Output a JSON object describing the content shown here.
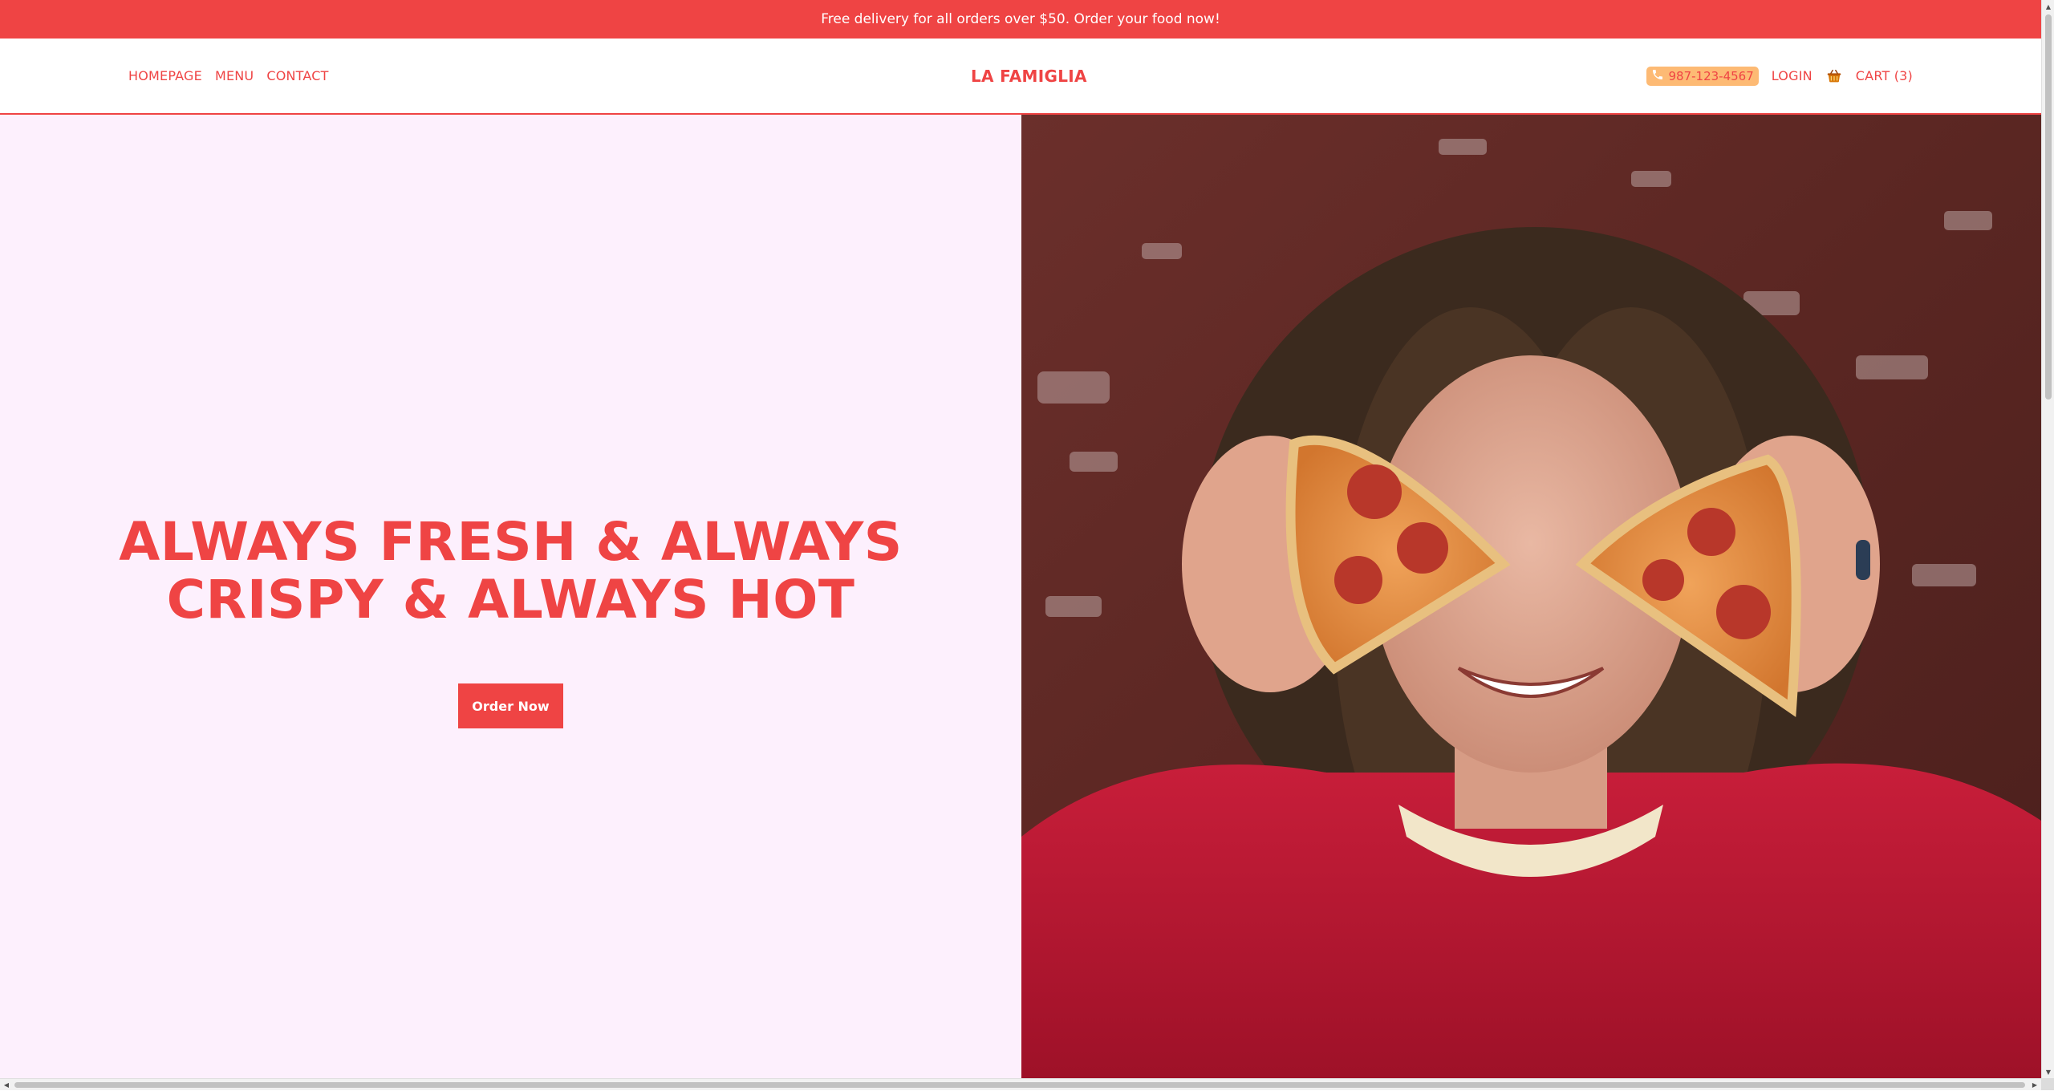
{
  "promo": {
    "text": "Free delivery for all orders over $50. Order your food now!"
  },
  "nav": {
    "links": [
      {
        "label": "HOMEPAGE"
      },
      {
        "label": "MENU"
      },
      {
        "label": "CONTACT"
      }
    ],
    "brand": "LA FAMIGLIA",
    "phone": {
      "icon": "phone-icon",
      "number": "987-123-4567"
    },
    "login": "LOGIN",
    "cart": {
      "icon": "basket-icon",
      "label": "CART (3)"
    }
  },
  "hero": {
    "title": "ALWAYS FRESH & ALWAYS CRISPY & ALWAYS HOT",
    "cta": "Order Now",
    "image": "photo: young man with long curly hair holding two pepperoni pizza slices over his eyes, red sweater, brick wall background"
  },
  "colors": {
    "accent": "#ef4444",
    "hero_bg": "#fdf0fd",
    "phone_pill": "#fdba74"
  }
}
